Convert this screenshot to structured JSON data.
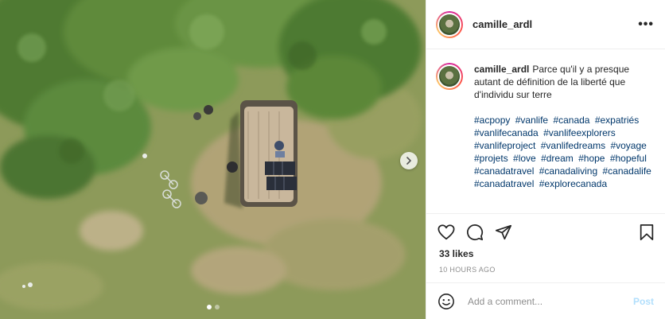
{
  "post": {
    "username": "camille_ardl",
    "more_label": "•••",
    "image_alt": "Aerial view of a camper van parked on a grassy field under trees",
    "carousel": {
      "slide_count": 2,
      "current_slide": 1
    }
  },
  "caption": {
    "username": "camille_ardl",
    "text": "Parce qu'il y a presque autant de définition de la liberté que d'individu sur terre",
    "hashtags": [
      "#acpopy",
      "#vanlife",
      "#canada",
      "#expatriés",
      "#vanlifecanada",
      "#vanlifeexplorers",
      "#vanlifeproject",
      "#vanlifedreams",
      "#voyage",
      "#projets",
      "#love",
      "#dream",
      "#hope",
      "#hopeful",
      "#canadatravel",
      "#canadaliving",
      "#canadalife",
      "#canadatravel",
      "#explorecanada"
    ]
  },
  "actions": {
    "icons": [
      "heart-icon",
      "comment-icon",
      "share-icon",
      "bookmark-icon"
    ]
  },
  "likes": "33 likes",
  "timestamp": "10 HOURS AGO",
  "comment_box": {
    "placeholder": "Add a comment...",
    "post_label": "Post"
  },
  "colors": {
    "link": "#00376b",
    "post_disabled": "#b2dffc",
    "muted": "#8e8e8e"
  }
}
